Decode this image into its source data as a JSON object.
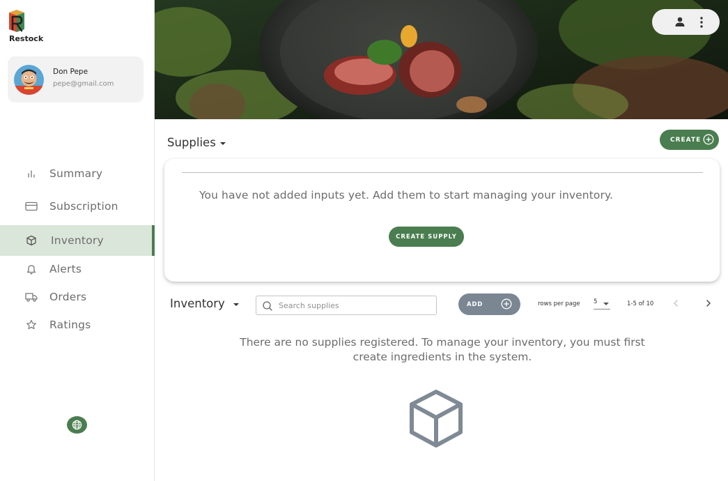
{
  "brand": {
    "name": "Restock"
  },
  "user": {
    "name": "Don Pepe",
    "email": "pepe@gmail.com"
  },
  "nav": {
    "items": [
      {
        "label": "Summary",
        "icon": "bar-chart-icon"
      },
      {
        "label": "Subscription",
        "icon": "credit-card-icon"
      },
      {
        "label": "Inventory",
        "icon": "cube-icon",
        "active": true
      },
      {
        "label": "Alerts",
        "icon": "bell-icon"
      },
      {
        "label": "Orders",
        "icon": "truck-icon"
      },
      {
        "label": "Ratings",
        "icon": "star-icon"
      }
    ]
  },
  "supplies": {
    "title": "Supplies",
    "create_label": "CREATE",
    "empty_message": "You have not added inputs yet. Add them to start managing your inventory.",
    "create_supply_label": "CREATE SUPPLY"
  },
  "inventory": {
    "title": "Inventory",
    "search_placeholder": "Search supplies",
    "add_label": "ADD",
    "rows_per_page_label": "rows per page",
    "rows_per_page_value": "5",
    "page_range": "1-5 of 10",
    "empty_message": "There are no supplies registered. To manage your inventory, you must first create ingredients in the system."
  },
  "colors": {
    "accent": "#4a7d4f",
    "active_nav_bg": "#dbe6da",
    "add_button": "#7b8693"
  }
}
